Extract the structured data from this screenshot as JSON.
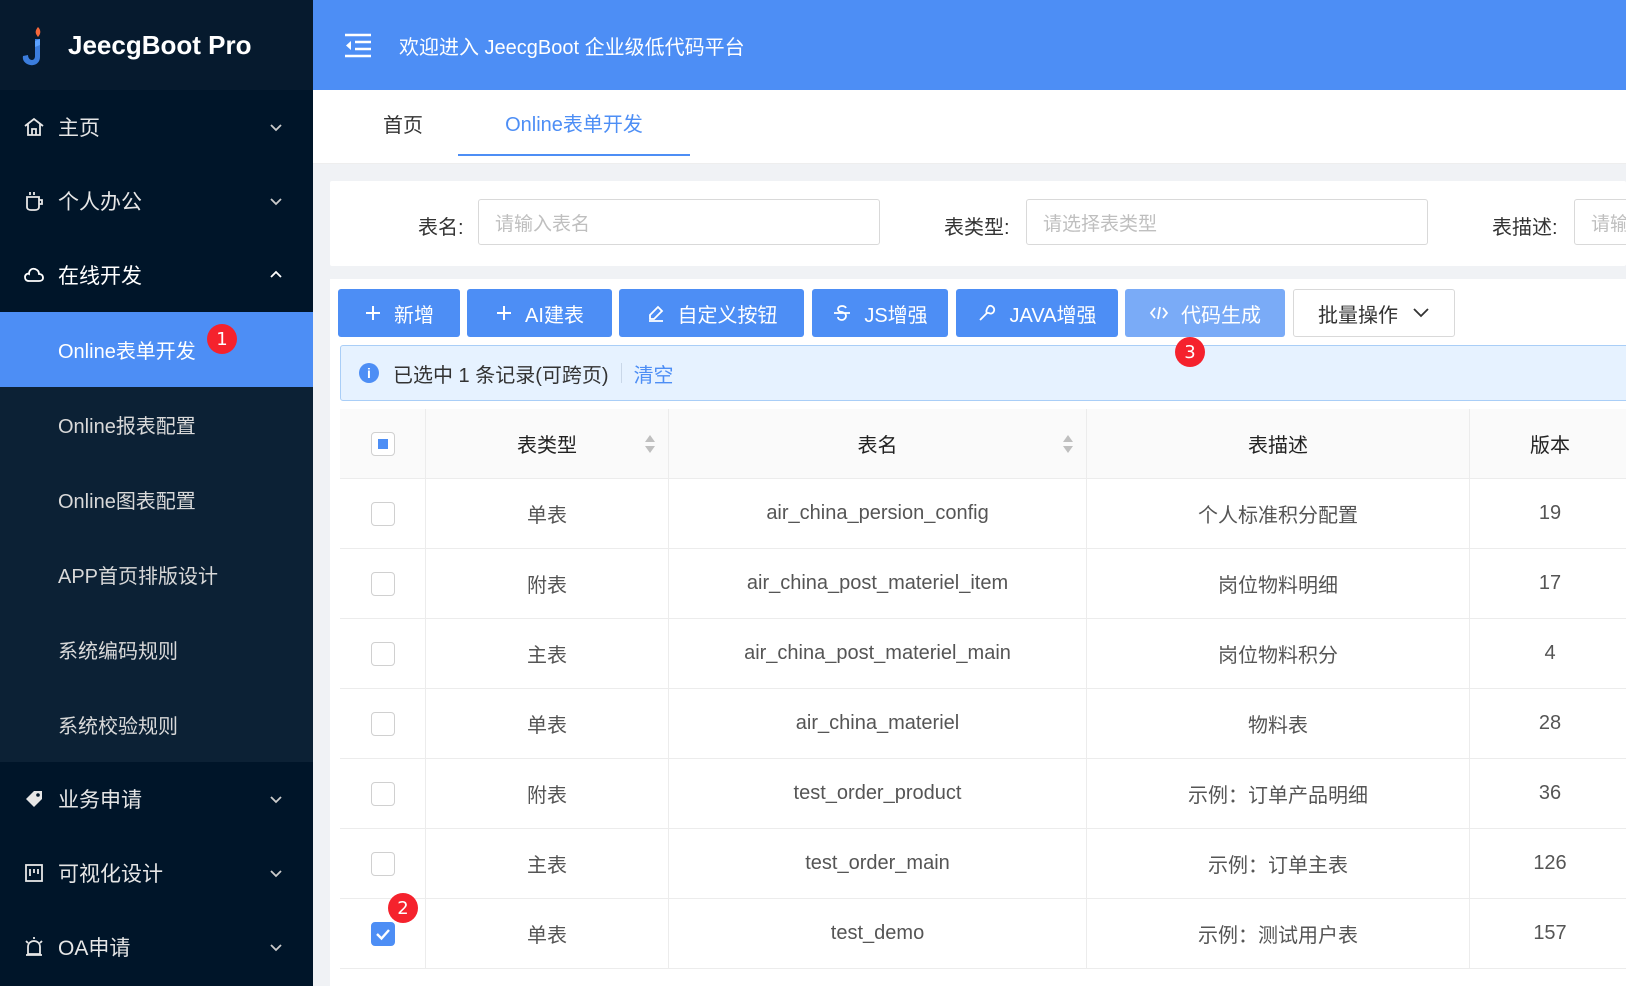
{
  "app": {
    "title": "JeecgBoot Pro"
  },
  "header": {
    "welcome": "欢迎进入 JeecgBoot 企业级低代码平台"
  },
  "sidebar": {
    "items": [
      {
        "label": "主页",
        "icon": "home-icon",
        "open": false
      },
      {
        "label": "个人办公",
        "icon": "coffee-icon",
        "open": false
      },
      {
        "label": "在线开发",
        "icon": "cloud-icon",
        "open": true
      },
      {
        "label": "业务申请",
        "icon": "tag-icon",
        "open": false
      },
      {
        "label": "可视化设计",
        "icon": "board-icon",
        "open": false
      },
      {
        "label": "OA申请",
        "icon": "alarm-icon",
        "open": false
      }
    ],
    "subitems": [
      {
        "label": "Online表单开发",
        "active": true
      },
      {
        "label": "Online报表配置"
      },
      {
        "label": "Online图表配置"
      },
      {
        "label": "APP首页排版设计"
      },
      {
        "label": "系统编码规则"
      },
      {
        "label": "系统校验规则"
      }
    ]
  },
  "tabs": [
    {
      "label": "首页"
    },
    {
      "label": "Online表单开发",
      "active": true
    }
  ],
  "search": {
    "name_label": "表名:",
    "name_placeholder": "请输入表名",
    "type_label": "表类型:",
    "type_placeholder": "请选择表类型",
    "desc_label": "表描述:",
    "desc_placeholder": "请输"
  },
  "toolbar": {
    "add": "新增",
    "ai": "AI建表",
    "custom": "自定义按钮",
    "js": "JS增强",
    "java": "JAVA增强",
    "codegen": "代码生成",
    "batch": "批量操作"
  },
  "alert": {
    "text": "已选中 1 条记录(可跨页)",
    "clear": "清空"
  },
  "badges": {
    "one": "1",
    "two": "2",
    "three": "3"
  },
  "table": {
    "columns": {
      "type": "表类型",
      "name": "表名",
      "desc": "表描述",
      "version": "版本"
    },
    "rows": [
      {
        "type": "单表",
        "name": "air_china_persion_config",
        "desc": "个人标准积分配置",
        "version": "19",
        "checked": false
      },
      {
        "type": "附表",
        "name": "air_china_post_materiel_item",
        "desc": "岗位物料明细",
        "version": "17",
        "checked": false
      },
      {
        "type": "主表",
        "name": "air_china_post_materiel_main",
        "desc": "岗位物料积分",
        "version": "4",
        "checked": false
      },
      {
        "type": "单表",
        "name": "air_china_materiel",
        "desc": "物料表",
        "version": "28",
        "checked": false
      },
      {
        "type": "附表",
        "name": "test_order_product",
        "desc": "示例：订单产品明细",
        "version": "36",
        "checked": false
      },
      {
        "type": "主表",
        "name": "test_order_main",
        "desc": "示例：订单主表",
        "version": "126",
        "checked": false
      },
      {
        "type": "单表",
        "name": "test_demo",
        "desc": "示例：测试用户表",
        "version": "157",
        "checked": true
      }
    ]
  },
  "colors": {
    "primary": "#4d8ef5",
    "sidebar": "#001529",
    "badge": "#f5222d"
  }
}
